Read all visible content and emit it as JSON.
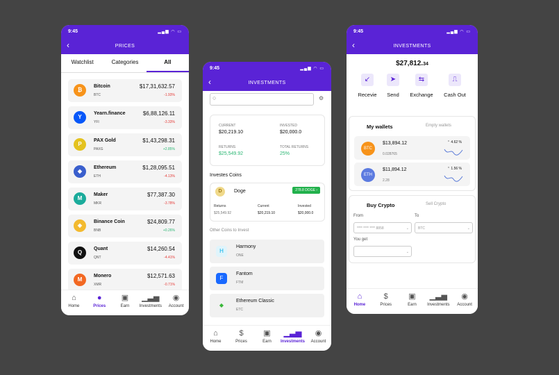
{
  "status_time": "9:45",
  "phone1": {
    "title": "PRICES",
    "tabs": [
      "Watchlist",
      "Categories",
      "All"
    ],
    "coins": [
      {
        "name": "Bitcoin",
        "ticker": "BTC",
        "price": "$17,31,632.57",
        "change": "-1.93%",
        "logo": "bitcoin-logo",
        "color": "#f7931a",
        "glyph": "₿"
      },
      {
        "name": "Yearn.finance",
        "ticker": "YFI",
        "price": "$6,88,126.11",
        "change": "-3.33%",
        "logo": "yearn-logo",
        "color": "#0657f9",
        "glyph": "Y"
      },
      {
        "name": "PAX Gold",
        "ticker": "PAXG",
        "price": "$1,43,298.31",
        "change": "+2.85%",
        "logo": "paxgold-logo",
        "color": "#e4c21f",
        "glyph": "P"
      },
      {
        "name": "Ethereum",
        "ticker": "ETH",
        "price": "$1,28,095.51",
        "change": "-4.13%",
        "logo": "ethereum-logo",
        "color": "#3a5fcd",
        "glyph": "◆"
      },
      {
        "name": "Maker",
        "ticker": "MKR",
        "price": "$77,387.30",
        "change": "-3.78%",
        "logo": "maker-logo",
        "color": "#1aab9b",
        "glyph": "M"
      },
      {
        "name": "Binance Coin",
        "ticker": "BNB",
        "price": "$24,809.77",
        "change": "+0.26%",
        "logo": "binance-logo",
        "color": "#f3ba2f",
        "glyph": "◈"
      },
      {
        "name": "Quant",
        "ticker": "QNT",
        "price": "$14,260.54",
        "change": "-4.41%",
        "logo": "quant-logo",
        "color": "#111111",
        "glyph": "Q"
      },
      {
        "name": "Monero",
        "ticker": "XMR",
        "price": "$12,571.63",
        "change": "-0.71%",
        "logo": "monero-logo",
        "color": "#f26822",
        "glyph": "M"
      }
    ],
    "nav": [
      "Home",
      "Prices",
      "Earn",
      "Investments",
      "Account"
    ]
  },
  "phone2": {
    "title": "INVESTMENTS",
    "summary": {
      "current_label": "CURRENT",
      "current": "$20,219.10",
      "invested_label": "INVESTED",
      "invested": "$20,000.0",
      "returns_label": "RETURNS",
      "returns": "$25,549.92",
      "total_label": "TOTAL RETURNS",
      "total": "25%"
    },
    "invested_heading": "Investes Coins",
    "doge": {
      "name": "Doge",
      "badge": "278.8 DOGE",
      "returns_label": "Returns",
      "returns": "$25,549.92",
      "current_label": "Current",
      "current": "$20,219.10",
      "invested_label": "Invested",
      "invested": "$20,000.0"
    },
    "other_heading": "Other Coins to Invest",
    "others": [
      {
        "name": "Harmony",
        "ticker": "ONE",
        "color": "#00aee9",
        "bg": "#e0f4fb",
        "glyph": "H"
      },
      {
        "name": "Fantom",
        "ticker": "FTM",
        "color": "#ffffff",
        "bg": "#1969ff",
        "glyph": "F"
      },
      {
        "name": "Ethereum Classic",
        "ticker": "ETC",
        "color": "#3ab83a",
        "bg": "#f1f1f1",
        "glyph": "◆"
      }
    ],
    "nav": [
      "Home",
      "Prices",
      "Earn",
      "Investments",
      "Account"
    ]
  },
  "phone3": {
    "title": "INVESTMENTS",
    "balance_main": "$27,812.",
    "balance_cents": "34",
    "actions": [
      "Recevie",
      "Send",
      "Exchange",
      "Cash Out"
    ],
    "wallet_tab": "My wallets",
    "empty_tab": "Empty wallets",
    "wallets": [
      {
        "ticker": "BTC",
        "amount": "$13,894.12",
        "qty": "0.028765",
        "pct": "4.62 %",
        "color": "#f7931a"
      },
      {
        "ticker": "ETH",
        "amount": "$11,894.12",
        "qty": "2.28",
        "pct": "1.56 %",
        "color": "#5c7be0"
      }
    ],
    "buy_tab": "Buy Crypto",
    "sell_tab": "Sell Crypto",
    "from_label": "From",
    "to_label": "To",
    "from_value": "**** **** **** 8858",
    "to_value": "BTC",
    "you_get_label": "You get",
    "nav": [
      "Home",
      "Prices",
      "Earn",
      "Investments",
      "Account"
    ]
  }
}
